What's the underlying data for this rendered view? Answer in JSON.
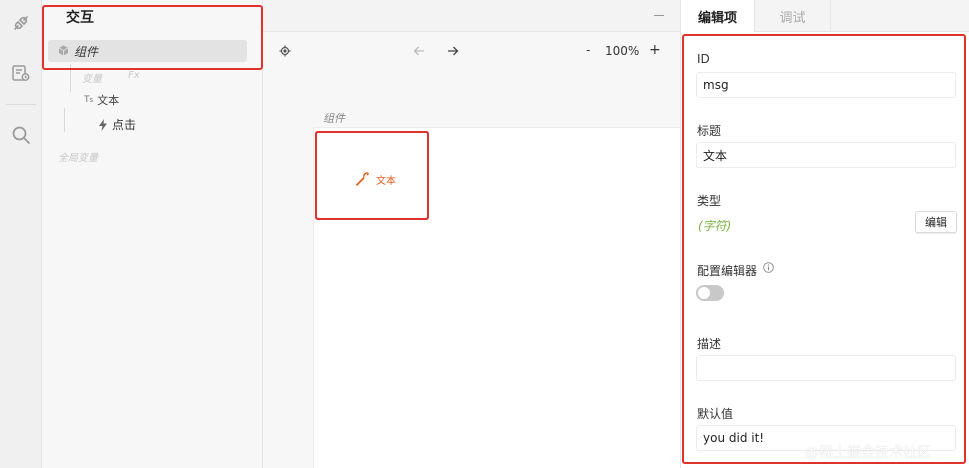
{
  "rail": {
    "icons": [
      "plugin-icon",
      "flow-settings-icon",
      "search-icon"
    ]
  },
  "tree": {
    "title": "交互",
    "selected_item": "组件",
    "faded_variables": "变量",
    "faded_fx": "Fx",
    "node_text": "文本",
    "node_click": "点击",
    "faded_global": "全局变量"
  },
  "canvas": {
    "zoom": "100%",
    "zoom_minus": "-",
    "zoom_plus": "+",
    "section_label": "组件",
    "component_name": "文本"
  },
  "inspector": {
    "tabs": [
      {
        "label": "编辑项",
        "active": true
      },
      {
        "label": "调试",
        "active": false
      }
    ],
    "id_label": "ID",
    "id_value": "msg",
    "title_label": "标题",
    "title_value": "文本",
    "type_label": "类型",
    "type_value": "(字符)",
    "edit_button": "编辑",
    "config_label": "配置编辑器",
    "config_enabled": false,
    "desc_label": "描述",
    "desc_value": "",
    "default_label": "默认值",
    "default_value": "you did it!"
  },
  "watermark": "@稀土掘金技术社区",
  "colors": {
    "highlight": "#e0312b",
    "accent_orange": "#e65c1a",
    "type_green": "#7cb342"
  }
}
